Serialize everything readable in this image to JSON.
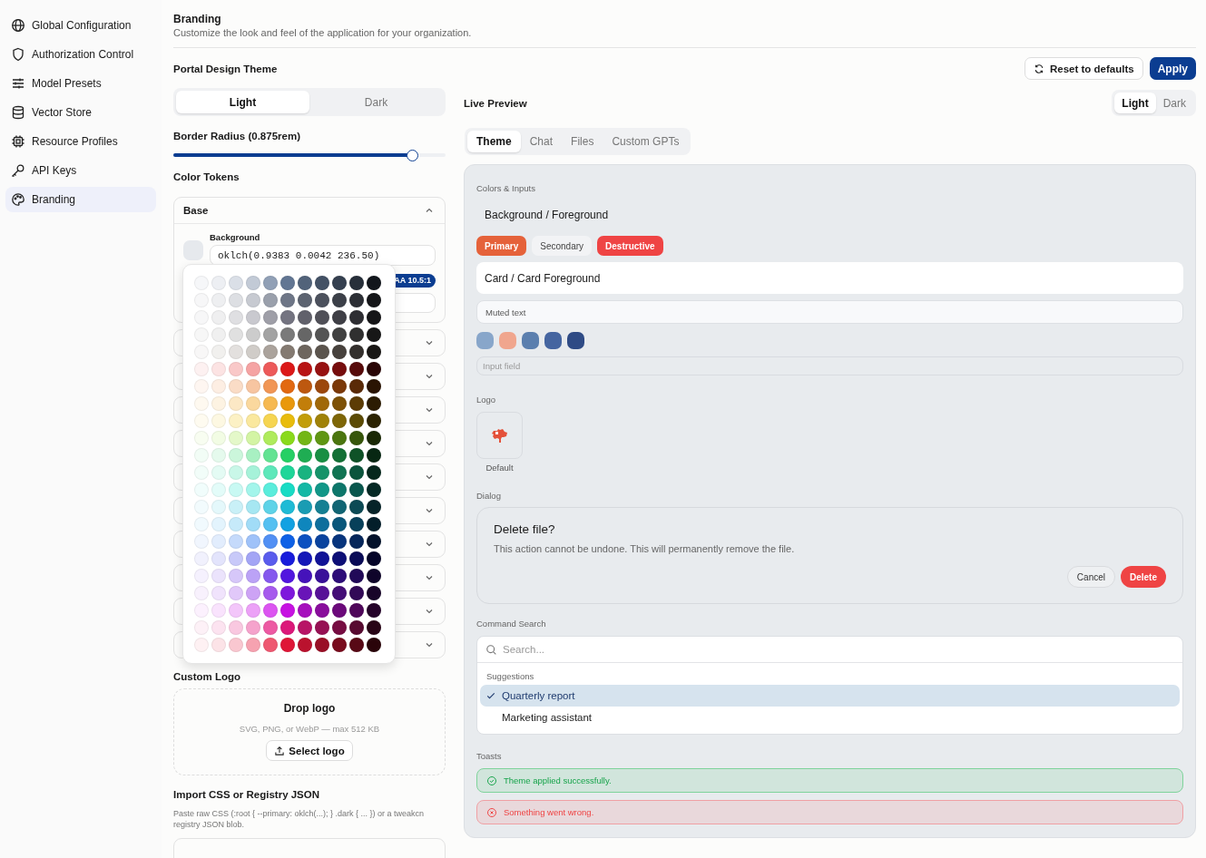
{
  "sidebar": {
    "items": [
      {
        "label": "Global Configuration",
        "selected": false
      },
      {
        "label": "Authorization Control",
        "selected": false
      },
      {
        "label": "Model Presets",
        "selected": false
      },
      {
        "label": "Vector Store",
        "selected": false
      },
      {
        "label": "Resource Profiles",
        "selected": false
      },
      {
        "label": "API Keys",
        "selected": false
      },
      {
        "label": "Branding",
        "selected": true
      }
    ]
  },
  "header": {
    "title": "Branding",
    "subtitle": "Customize the look and feel of the application for your organization."
  },
  "actions": {
    "reset": "Reset to defaults",
    "apply": "Apply"
  },
  "editor": {
    "section_title": "Portal Design Theme",
    "mode_tabs": [
      {
        "label": "Light",
        "selected": true
      },
      {
        "label": "Dark",
        "selected": false
      }
    ],
    "radius": {
      "label": "Border Radius (0.875rem)",
      "level": 0.877
    },
    "tokens_title": "Color Tokens",
    "groups": [
      {
        "label": "Base",
        "expanded": true,
        "fields": [
          {
            "label": "Background",
            "value": "oklch(0.9383 0.0042 236.50)",
            "color": "#e6e9ed",
            "picker_open": true,
            "contrast_badge": "AA 10.5:1"
          }
        ]
      },
      {
        "expanded": false
      },
      {
        "expanded": false
      },
      {
        "expanded": false
      },
      {
        "expanded": false
      },
      {
        "expanded": false
      },
      {
        "expanded": false
      },
      {
        "expanded": false
      },
      {
        "expanded": false
      },
      {
        "expanded": false
      },
      {
        "expanded": false
      }
    ],
    "logo": {
      "title": "Custom Logo",
      "drop_title": "Drop logo",
      "hint": "SVG, PNG, or WebP — max 512 KB",
      "button": "Select logo"
    },
    "import": {
      "title": "Import CSS or Registry JSON",
      "description": "Paste raw CSS (:root { --primary: oklch(...); } .dark { ... }) or a tweakcn registry JSON blob."
    }
  },
  "preview": {
    "title": "Live Preview",
    "mode_tabs": [
      {
        "label": "Light",
        "selected": true
      },
      {
        "label": "Dark",
        "selected": false
      }
    ],
    "tabs": [
      {
        "label": "Theme",
        "selected": true
      },
      {
        "label": "Chat",
        "selected": false
      },
      {
        "label": "Files",
        "selected": false
      },
      {
        "label": "Custom GPTs",
        "selected": false
      }
    ],
    "colors_label": "Colors & Inputs",
    "background_text": "Background / Foreground",
    "buttons": [
      {
        "label": "Primary",
        "kind": "primary"
      },
      {
        "label": "Secondary",
        "kind": "secondary"
      },
      {
        "label": "Destructive",
        "kind": "destructive"
      }
    ],
    "card_text": "Card / Card Foreground",
    "muted_text": "Muted text",
    "swatches": [
      {
        "color": "#88a6ca"
      },
      {
        "color": "#f0a68e"
      },
      {
        "color": "#5b7fae"
      },
      {
        "color": "#4565a0"
      },
      {
        "color": "#2f4b85"
      }
    ],
    "input_placeholder": "Input field",
    "logo_label": "Logo",
    "logo_caption": "Default",
    "dialog_label": "Dialog",
    "dialog": {
      "title": "Delete file?",
      "description": "This action cannot be undone. This will permanently remove the file.",
      "buttons": [
        {
          "label": "Cancel",
          "kind": "outline"
        },
        {
          "label": "Delete",
          "kind": "destructive"
        }
      ]
    },
    "command_label": "Command Search",
    "command": {
      "placeholder": "Search...",
      "group": "Suggestions",
      "items": [
        {
          "label": "Quarterly report",
          "selected": true
        },
        {
          "label": "Marketing assistant",
          "selected": false
        }
      ]
    },
    "toasts_label": "Toasts",
    "toasts": [
      {
        "kind": "success",
        "text": "Theme applied successfully."
      },
      {
        "kind": "error",
        "text": "Something went wrong."
      }
    ]
  }
}
